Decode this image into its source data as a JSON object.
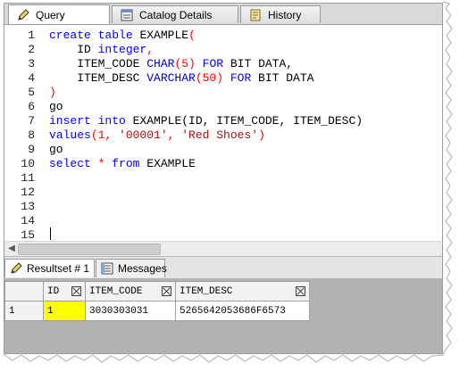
{
  "tabs": [
    {
      "label": "Query",
      "icon": "pencil-icon",
      "active": true
    },
    {
      "label": "Catalog Details",
      "icon": "catalog-icon",
      "active": false
    },
    {
      "label": "History",
      "icon": "history-icon",
      "active": false
    }
  ],
  "editor": {
    "line_numbers": [
      "1",
      "2",
      "3",
      "4",
      "5",
      "6",
      "7",
      "8",
      "9",
      "10",
      "11",
      "12",
      "13",
      "14",
      "15"
    ],
    "lines": [
      [
        "create",
        " ",
        "table",
        " EXAMPLE",
        "("
      ],
      [
        "    ID ",
        "integer",
        ","
      ],
      [
        "    ITEM_CODE ",
        "CHAR",
        "(5) ",
        "FOR",
        " BIT DATA,"
      ],
      [
        "    ITEM_DESC ",
        "VARCHAR",
        "(50) ",
        "FOR",
        " BIT DATA"
      ],
      [
        ")"
      ],
      [
        "go"
      ],
      [
        "insert",
        " ",
        "into",
        " EXAMPLE(ID, ITEM_CODE, ITEM_DESC)"
      ],
      [
        "values",
        "(1, ",
        "'00001'",
        ", ",
        "'Red Shoes'",
        ")"
      ],
      [
        "go"
      ],
      [
        "select",
        " ",
        "*",
        " ",
        "from",
        " EXAMPLE"
      ]
    ]
  },
  "results": {
    "tabs": [
      {
        "label": "Resultset # 1",
        "icon": "resultset-icon",
        "active": true
      },
      {
        "label": "Messages",
        "icon": "messages-icon",
        "active": false
      }
    ],
    "columns": [
      "ID",
      "ITEM_CODE",
      "ITEM_DESC"
    ],
    "rows": [
      {
        "num": "1",
        "cells": [
          "1",
          "3030303031",
          "5265642053686F6573"
        ]
      }
    ]
  },
  "colors": {
    "keyword": "#0000ff",
    "symbol": "#ff0000",
    "string": "#a31515",
    "selected_cell": "#ffff00"
  }
}
